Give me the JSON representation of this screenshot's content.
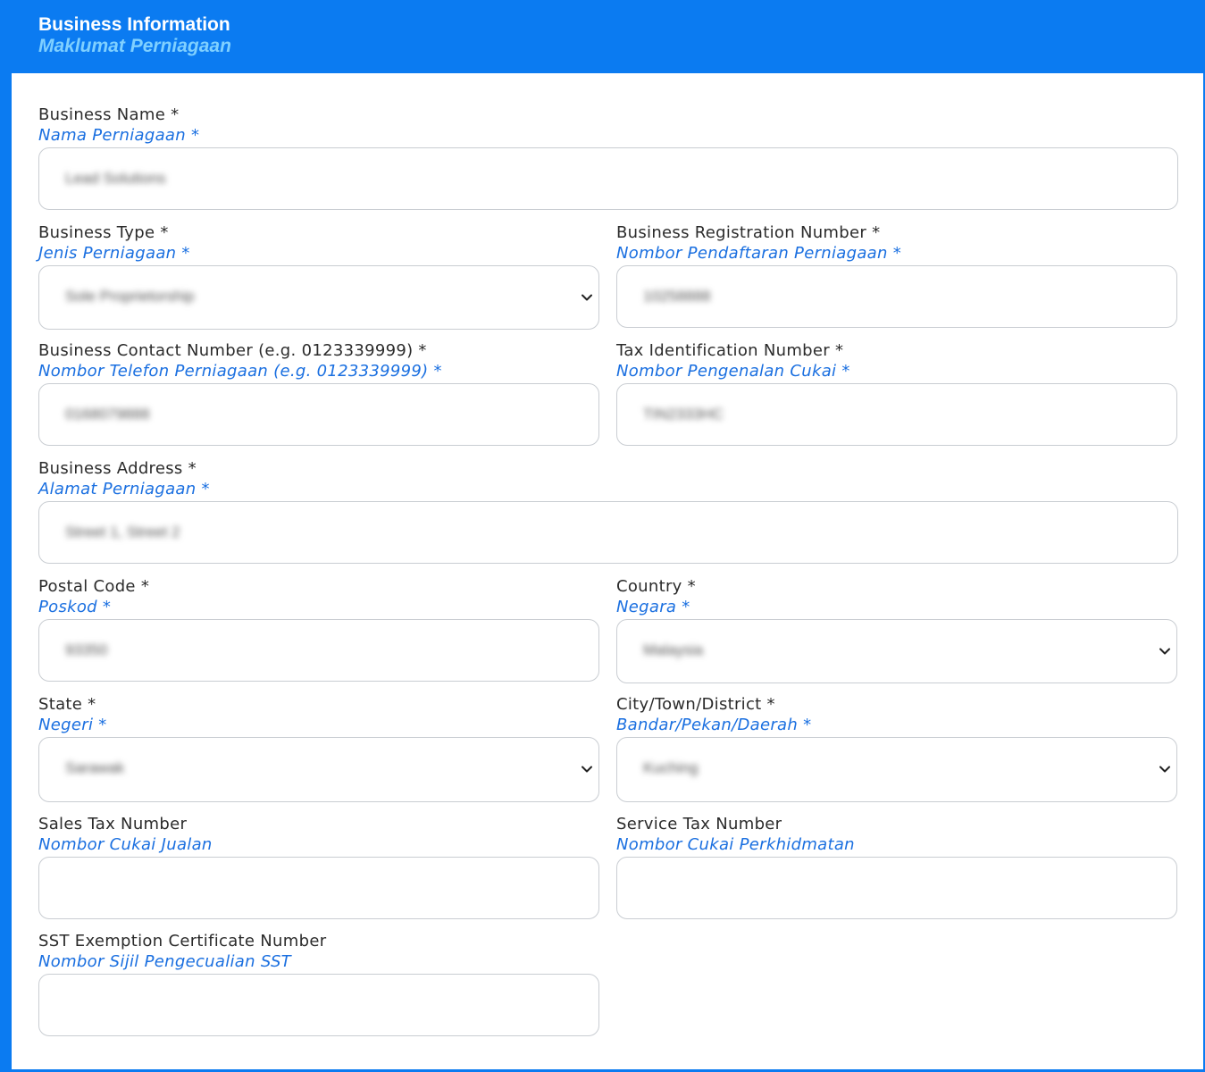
{
  "header": {
    "title": "Business Information",
    "subtitle": "Maklumat Perniagaan"
  },
  "fields": {
    "business_name": {
      "label": "Business Name *",
      "label_ms": "Nama Perniagaan *",
      "value": "Lead Solutions"
    },
    "business_type": {
      "label": "Business Type *",
      "label_ms": "Jenis Perniagaan *",
      "value": "Sole Proprietorship"
    },
    "business_registration_number": {
      "label": "Business Registration Number *",
      "label_ms": "Nombor Pendaftaran Perniagaan *",
      "value": "10258888"
    },
    "business_contact_number": {
      "label": "Business Contact Number (e.g. 0123339999) *",
      "label_ms": "Nombor Telefon Perniagaan (e.g. 0123339999) *",
      "value": "0168079888"
    },
    "tax_identification_number": {
      "label": "Tax Identification Number *",
      "label_ms": "Nombor Pengenalan Cukai *",
      "value": "TIN2333HC"
    },
    "business_address": {
      "label": "Business Address *",
      "label_ms": "Alamat Perniagaan *",
      "value": "Street 1, Street 2"
    },
    "postal_code": {
      "label": "Postal Code *",
      "label_ms": "Poskod *",
      "value": "93350"
    },
    "country": {
      "label": "Country *",
      "label_ms": "Negara *",
      "value": "Malaysia"
    },
    "state": {
      "label": "State *",
      "label_ms": "Negeri *",
      "value": "Sarawak"
    },
    "city": {
      "label": "City/Town/District *",
      "label_ms": "Bandar/Pekan/Daerah *",
      "value": "Kuching"
    },
    "sales_tax_number": {
      "label": "Sales Tax Number",
      "label_ms": "Nombor Cukai Jualan",
      "value": ""
    },
    "service_tax_number": {
      "label": "Service Tax Number",
      "label_ms": "Nombor Cukai Perkhidmatan",
      "value": ""
    },
    "sst_exemption_certificate_number": {
      "label": "SST Exemption Certificate Number",
      "label_ms": "Nombor Sijil Pengecualian SST",
      "value": ""
    }
  },
  "icons": {
    "select_chevron": "chevron-down-icon"
  },
  "colors": {
    "brand_blue": "#0b7bf1",
    "subtitle_cyan": "#7fd0ff",
    "malay_label_blue": "#1a6fe0"
  }
}
